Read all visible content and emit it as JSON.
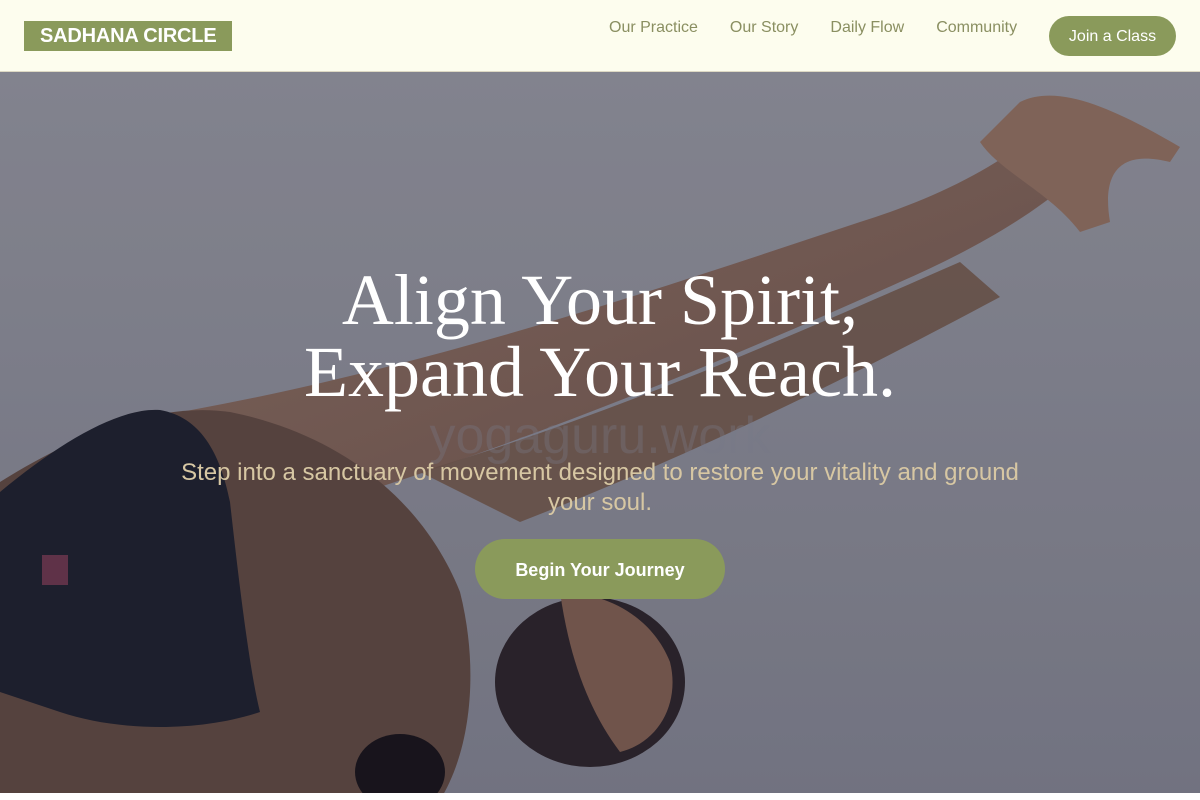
{
  "brand": {
    "name": "SADHANA CIRCLE",
    "accent": "#8a9a5b",
    "header_bg": "#fdfdee",
    "nav_color": "#8a8f61",
    "subtitle_color": "#d7c7a3"
  },
  "nav": {
    "items": [
      {
        "label": "Our Practice"
      },
      {
        "label": "Our Story"
      },
      {
        "label": "Daily Flow"
      },
      {
        "label": "Community"
      }
    ],
    "cta_label": "Join a Class"
  },
  "hero": {
    "headline_line1": "Align Your Spirit,",
    "headline_line2": "Expand Your Reach.",
    "subtitle": "Step into a sanctuary of movement designed to restore your vitality and ground your soul.",
    "button_label": "Begin Your Journey",
    "watermark": "yogaguru.work",
    "image_subject": "woman in yoga stretch reaching arm forward"
  }
}
